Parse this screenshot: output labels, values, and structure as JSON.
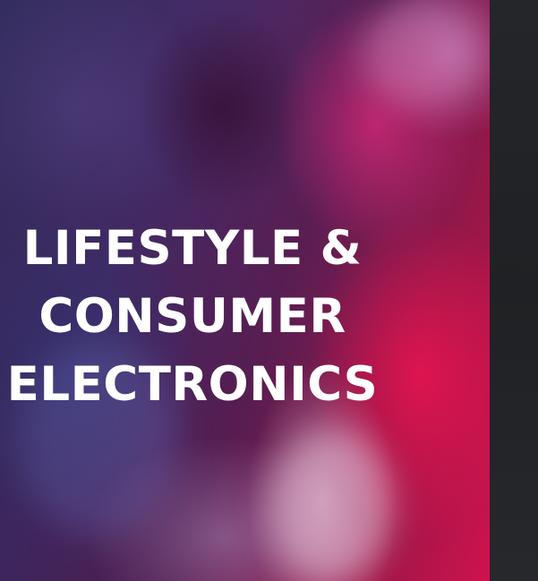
{
  "hero": {
    "title_lines": [
      "LIFESTYLE &",
      "CONSUMER",
      "ELECTRONICS"
    ]
  },
  "colors": {
    "background": "#202124",
    "title": "#ffffff",
    "accent_magenta": "#d0124e",
    "accent_violet": "#4a2f6e"
  }
}
